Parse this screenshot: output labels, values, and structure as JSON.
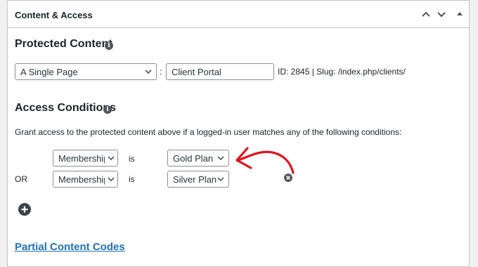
{
  "panel": {
    "title": "Content & Access",
    "header_icons": [
      "chevron-up-icon",
      "chevron-down-icon",
      "collapse-arrow-icon"
    ]
  },
  "protected_content": {
    "title": "Protected Content",
    "info_icon": "info-icon",
    "type_select": "A Single Page",
    "separator": ":",
    "page_input": "Client Portal",
    "meta": "ID: 2845 | Slug: /index.php/clients/"
  },
  "access_conditions": {
    "title": "Access Conditions",
    "description": "Grant access to the protected content above if a logged-in user matches any of the following conditions:",
    "rows": [
      {
        "prefix": "",
        "field": "Membership",
        "operator": "is",
        "value": "Gold Plan"
      },
      {
        "prefix": "OR",
        "field": "Membership",
        "operator": "is",
        "value": "Silver Plan"
      }
    ],
    "remove_icon": "remove-condition-icon",
    "add_icon": "add-condition-icon"
  },
  "partial_content_link": "Partial Content Codes",
  "colors": {
    "link": "#2271b1",
    "annotation_arrow": "#e0121e",
    "border": "#c3c4c7"
  }
}
